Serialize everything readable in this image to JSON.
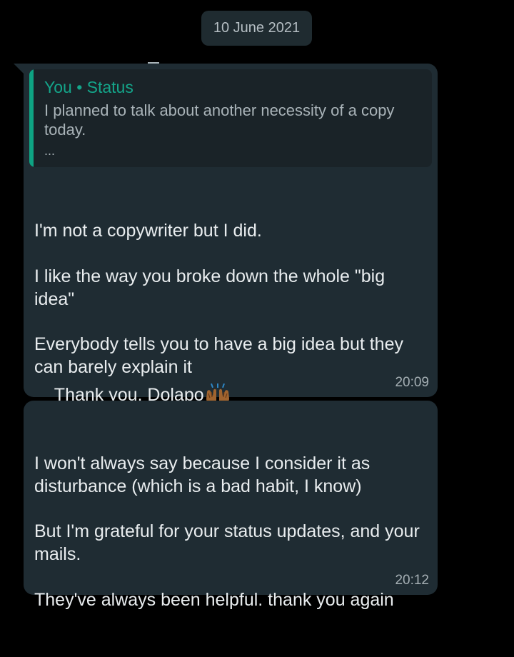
{
  "date_label": "10 June 2021",
  "messages": [
    {
      "quote": {
        "author": "You • Status",
        "text": "I planned to talk about another necessity of a copy today.",
        "more": "..."
      },
      "paragraphs": [
        "I'm not a copywriter but I did.",
        "I like the way you broke down the whole \"big idea\"",
        "Everybody tells you to have a big idea but they can barely explain it",
        "Thank you, Dolapo"
      ],
      "emoji": "raising-hands-icon",
      "time": "20:09"
    },
    {
      "paragraphs": [
        "I won't always say because I consider it as disturbance (which is a bad habit, I know)",
        "But I'm grateful for your status updates, and your mails.",
        "They've always been helpful. thank you again"
      ],
      "time": "20:12"
    }
  ],
  "colors": {
    "background": "#000000",
    "bubble": "#1f2c33",
    "accent": "#0ea383",
    "text": "#e9edef",
    "muted": "#a5afb4"
  }
}
